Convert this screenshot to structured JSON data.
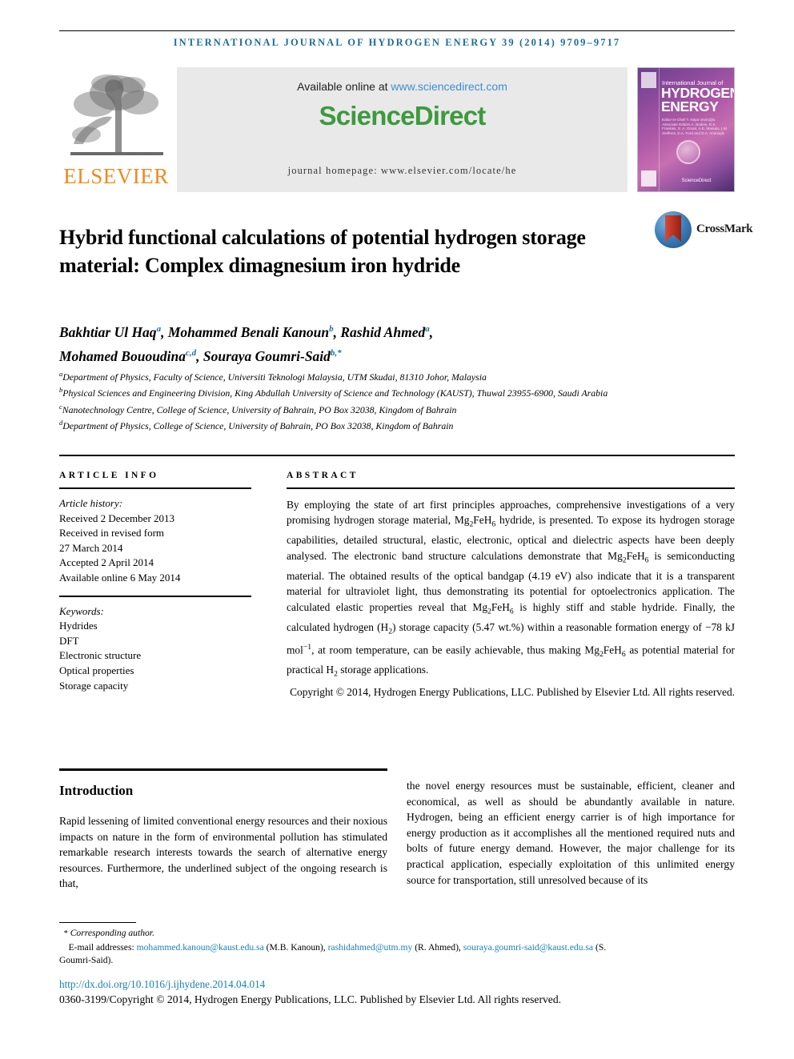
{
  "running_head": "International Journal of Hydrogen Energy 39 (2014) 9709–9717",
  "masthead": {
    "available_prefix": "Available online at ",
    "available_url": "www.sciencedirect.com",
    "logo_part1": "Science",
    "logo_part2": "Direct",
    "journal_homepage": "journal homepage: www.elsevier.com/locate/he",
    "publisher_name": "ELSEVIER",
    "cover": {
      "line1": "International Journal of",
      "line2": "HYDROGEN",
      "line3": "ENERGY",
      "editors": "Editor-in-Chief  T. Nejat Veziroğlu\nAssociate Editors  A. Bodies, D.S. Frankiss, S. A. Gross, A.E. Masuko, I.W. Steffens, D.A. Ford and D.A. Aminoglu",
      "science_direct": "ScienceDirect"
    }
  },
  "crossmark": {
    "label": "CrossMark"
  },
  "article": {
    "title": "Hybrid functional calculations of potential hydrogen storage material: Complex dimagnesium iron hydride",
    "authors_line1_a": "Bakhtiar Ul Haq",
    "authors_line1_a_sup": "a",
    "authors_line1_b": ", Mohammed Benali Kanoun",
    "authors_line1_b_sup": "b",
    "authors_line1_c": ", Rashid Ahmed",
    "authors_line1_c_sup": "a",
    "authors_line1_tail": ",",
    "authors_line2_a": "Mohamed Bououdina",
    "authors_line2_a_sup": "c,d",
    "authors_line2_b": ", Souraya Goumri-Said",
    "authors_line2_b_sup": "b,*",
    "affiliations": [
      {
        "marker": "a",
        "text": "Department of Physics, Faculty of Science, Universiti Teknologi Malaysia, UTM Skudai, 81310 Johor, Malaysia"
      },
      {
        "marker": "b",
        "text": "Physical Sciences and Engineering Division, King Abdullah University of Science and Technology (KAUST), Thuwal 23955-6900, Saudi Arabia"
      },
      {
        "marker": "c",
        "text": "Nanotechnology Centre, College of Science, University of Bahrain, PO Box 32038, Kingdom of Bahrain"
      },
      {
        "marker": "d",
        "text": "Department of Physics, College of Science, University of Bahrain, PO Box 32038, Kingdom of Bahrain"
      }
    ]
  },
  "article_info": {
    "heading": "ARTICLE INFO",
    "history_label": "Article history:",
    "history": [
      "Received 2 December 2013",
      "Received in revised form",
      "27 March 2014",
      "Accepted 2 April 2014",
      "Available online 6 May 2014"
    ],
    "keywords_label": "Keywords:",
    "keywords": [
      "Hydrides",
      "DFT",
      "Electronic structure",
      "Optical properties",
      "Storage capacity"
    ]
  },
  "abstract": {
    "heading": "ABSTRACT",
    "part1": "By employing the state of art first principles approaches, comprehensive investigations of a very promising hydrogen storage material, Mg",
    "f1_sub": "2",
    "part2": "FeH",
    "f2_sub": "6",
    "part3": " hydride, is presented. To expose its hydrogen storage capabilities, detailed structural, elastic, electronic, optical and dielectric aspects have been deeply analysed. The electronic band structure calculations demonstrate that Mg",
    "f3_sub": "2",
    "part4": "FeH",
    "f4_sub": "6",
    "part5": " is semiconducting material. The obtained results of the optical bandgap (4.19 eV) also indicate that it is a transparent material for ultraviolet light, thus demonstrating its potential for optoelectronics application. The calculated elastic properties reveal that Mg",
    "f5_sub": "2",
    "part6": "FeH",
    "f6_sub": "6",
    "part7": " is highly stiff and stable hydride. Finally, the calculated hydrogen (H",
    "f7_sub": "2",
    "part8": ") storage capacity (5.47 wt.%) within a reasonable formation energy of −78 kJ mol",
    "f8_sup": "−1",
    "part9": ", at room temperature, can be easily achievable, thus making Mg",
    "f9_sub": "2",
    "part10": "FeH",
    "f10_sub": "6",
    "part11": " as potential material for practical H",
    "f11_sub": "2",
    "part12": " storage applications.",
    "copyright": "Copyright © 2014, Hydrogen Energy Publications, LLC. Published by Elsevier Ltd. All rights reserved."
  },
  "introduction": {
    "heading": "Introduction",
    "left_column": "Rapid lessening of limited conventional energy resources and their noxious impacts on nature in the form of environmental pollution has stimulated remarkable research interests towards the search of alternative energy resources. Furthermore, the underlined subject of the ongoing research is that,",
    "right_column": "the novel energy resources must be sustainable, efficient, cleaner and economical, as well as should be abundantly available in nature. Hydrogen, being an efficient energy carrier is of high importance for energy production as it accomplishes all the mentioned required nuts and bolts of future energy demand. However, the major challenge for its practical application, especially exploitation of this unlimited energy source for transportation, still unresolved because of its"
  },
  "footnote": {
    "star": "*",
    "corresponding": "Corresponding author.",
    "email_label": "E-mail addresses:",
    "email1": "mohammed.kanoun@kaust.edu.sa",
    "name1": "(M.B. Kanoun),",
    "email2": "rashidahmed@utm.my",
    "name2": "(R. Ahmed),",
    "email3": "souraya.goumri-said@kaust.edu.sa",
    "name3": "(S. Goumri-Said)."
  },
  "footer": {
    "doi": "http://dx.doi.org/10.1016/j.ijhydene.2014.04.014",
    "copyright": "0360-3199/Copyright © 2014, Hydrogen Energy Publications, LLC. Published by Elsevier Ltd. All rights reserved."
  },
  "colors": {
    "journal_blue": "#1b6c9c",
    "link_blue": "#1b7fb5",
    "sciencedirect_green": "#3d9a3d",
    "elsevier_orange": "#f08a20"
  }
}
